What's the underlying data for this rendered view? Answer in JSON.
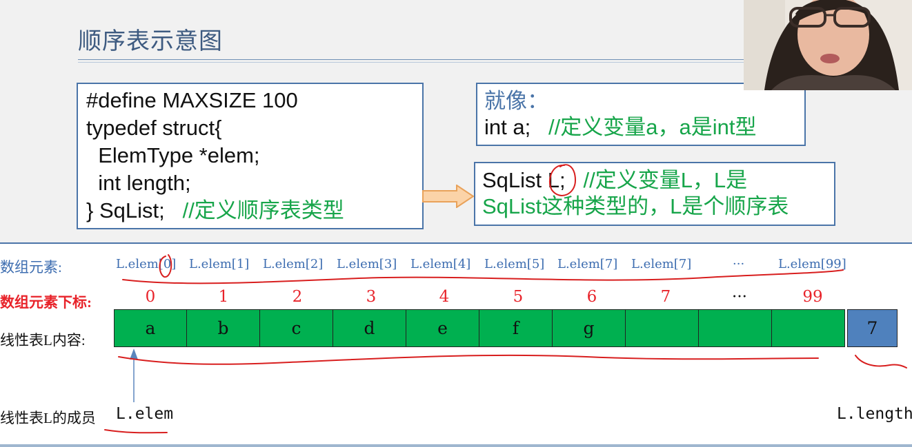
{
  "slide": {
    "title": "顺序表示意图"
  },
  "code_box": {
    "lines": [
      "#define MAXSIZE 100",
      "typedef struct{",
      "  ElemType *elem;",
      "  int length;",
      "} SqList;   "
    ],
    "comment": "//定义顺序表类型"
  },
  "like_box": {
    "heading": "就像：",
    "code": "int a;   ",
    "comment": "//定义变量a，a是int型"
  },
  "sqlist_box": {
    "code": "SqList L;   ",
    "comment_line1": "//定义变量L，L是",
    "comment_line2": "SqList这种类型的，L是个顺序表"
  },
  "array": {
    "row_labels": {
      "elements": "数组元素:",
      "indices": "数组元素下标:",
      "content": "线性表L内容:",
      "members": "线性表L的成员"
    },
    "element_labels": [
      "L.elem[0]",
      "L.elem[1]",
      "L.elem[2]",
      "L.elem[3]",
      "L.elem[4]",
      "L.elem[5]",
      "L.elem[7]",
      "L.elem[7]",
      "···",
      "L.elem[99]"
    ],
    "indices": [
      "0",
      "1",
      "2",
      "3",
      "4",
      "5",
      "6",
      "7",
      "···",
      "99"
    ],
    "cells": [
      "a",
      "b",
      "c",
      "d",
      "e",
      "f",
      "g",
      "",
      "",
      ""
    ],
    "length_value": "7",
    "member_elem": "L.elem",
    "member_length": "L.length"
  },
  "colors": {
    "cell_fill": "#00b050",
    "length_fill": "#4f81bd",
    "accent_blue": "#4a74a8",
    "index_red": "#e8232a",
    "comment_green": "#17a54a",
    "annotation_red": "#d81e1e"
  }
}
